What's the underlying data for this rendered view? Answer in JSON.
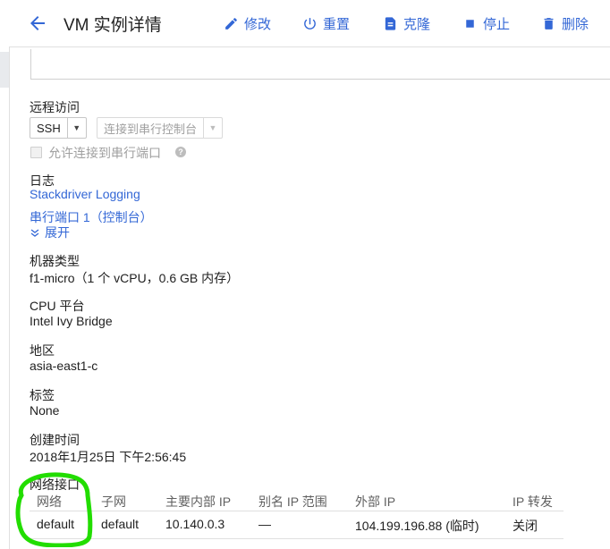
{
  "header": {
    "title": "VM 实例详情",
    "actions": [
      {
        "label": "修改",
        "icon": "edit-icon"
      },
      {
        "label": "重置",
        "icon": "power-icon"
      },
      {
        "label": "克隆",
        "icon": "clone-icon"
      },
      {
        "label": "停止",
        "icon": "stop-icon"
      },
      {
        "label": "删除",
        "icon": "trash-icon"
      }
    ]
  },
  "remote_access": {
    "heading": "远程访问",
    "ssh_label": "SSH",
    "serial_label": "连接到串行控制台",
    "checkbox_label": "允许连接到串行端口",
    "checkbox_checked": false
  },
  "logs": {
    "heading": "日志",
    "stackdriver_link": "Stackdriver Logging",
    "serial_port_link": "串行端口 1（控制台）",
    "expand_label": "展开"
  },
  "machine_type": {
    "heading": "机器类型",
    "value": "f1-micro（1 个 vCPU，0.6 GB 内存）"
  },
  "cpu_platform": {
    "heading": "CPU 平台",
    "value": "Intel Ivy Bridge"
  },
  "zone": {
    "heading": "地区",
    "value": "asia-east1-c"
  },
  "labels": {
    "heading": "标签",
    "value": "None"
  },
  "created": {
    "heading": "创建时间",
    "value": "2018年1月25日 下午2:56:45"
  },
  "network": {
    "heading": "网络接口",
    "columns": [
      "网络",
      "子网",
      "主要内部 IP",
      "别名 IP 范围",
      "外部 IP",
      "IP 转发"
    ],
    "rows": [
      [
        "default",
        "default",
        "10.140.0.3",
        "—",
        "104.199.196.88 (临时)",
        "关闭"
      ]
    ]
  },
  "colors": {
    "accent": "#3367d6",
    "annotation": "#22dd00"
  }
}
